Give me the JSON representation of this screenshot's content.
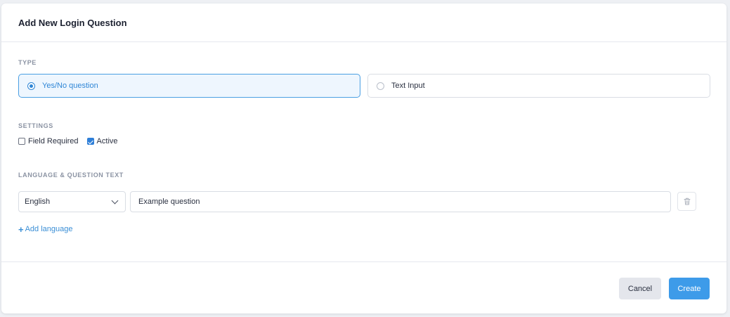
{
  "dialog": {
    "title": "Add New Login Question"
  },
  "type_section": {
    "label": "TYPE",
    "options": [
      {
        "label": "Yes/No question",
        "selected": true
      },
      {
        "label": "Text Input",
        "selected": false
      }
    ]
  },
  "settings_section": {
    "label": "SETTINGS",
    "field_required": {
      "label": "Field Required",
      "checked": false
    },
    "active": {
      "label": "Active",
      "checked": true
    }
  },
  "language_section": {
    "label": "LANGUAGE & QUESTION TEXT",
    "language_value": "English",
    "question_value": "Example question",
    "add_language_label": "Add language"
  },
  "footer": {
    "cancel_label": "Cancel",
    "create_label": "Create"
  },
  "colors": {
    "accent": "#3d9be9",
    "selected_bg": "#eef6fe",
    "selected_border": "#4a9fe3"
  },
  "icons": {
    "delete": "trash-icon",
    "add": "plus-icon",
    "dropdown": "chevron-down-icon"
  }
}
